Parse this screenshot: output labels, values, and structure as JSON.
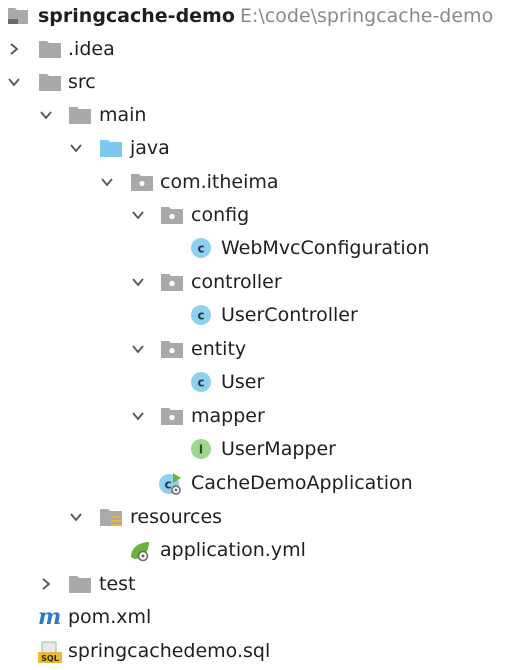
{
  "tree": {
    "root": {
      "label": "springcache-demo",
      "path": "E:\\code\\springcache-demo",
      "icon": "project-folder-icon"
    },
    "items": [
      {
        "label": ".idea",
        "icon": "folder-icon",
        "expanded": false
      },
      {
        "label": "src",
        "icon": "folder-icon",
        "expanded": true
      },
      {
        "label": "main",
        "icon": "folder-icon",
        "expanded": true
      },
      {
        "label": "java",
        "icon": "source-folder-icon",
        "expanded": true
      },
      {
        "label": "com.itheima",
        "icon": "package-icon",
        "expanded": true
      },
      {
        "label": "config",
        "icon": "package-icon",
        "expanded": true
      },
      {
        "label": "WebMvcConfiguration",
        "icon": "class-icon"
      },
      {
        "label": "controller",
        "icon": "package-icon",
        "expanded": true
      },
      {
        "label": "UserController",
        "icon": "class-icon"
      },
      {
        "label": "entity",
        "icon": "package-icon",
        "expanded": true
      },
      {
        "label": "User",
        "icon": "class-icon"
      },
      {
        "label": "mapper",
        "icon": "package-icon",
        "expanded": true
      },
      {
        "label": "UserMapper",
        "icon": "interface-icon"
      },
      {
        "label": "CacheDemoApplication",
        "icon": "spring-boot-class-icon"
      },
      {
        "label": "resources",
        "icon": "resources-folder-icon",
        "expanded": true
      },
      {
        "label": "application.yml",
        "icon": "spring-yml-icon"
      },
      {
        "label": "test",
        "icon": "folder-icon",
        "expanded": false
      },
      {
        "label": "pom.xml",
        "icon": "maven-icon"
      },
      {
        "label": "springcachedemo.sql",
        "icon": "sql-file-icon"
      }
    ]
  },
  "colors": {
    "folder": "#a9a9a9",
    "source_folder": "#7dc9ee",
    "class_badge": "#8fd0ef",
    "interface_badge": "#9fd58f",
    "spring_green": "#6cb33e",
    "maven_blue": "#2f7bbf",
    "sql_yellow": "#e8b93a",
    "path_gray": "#8a8a8a"
  }
}
